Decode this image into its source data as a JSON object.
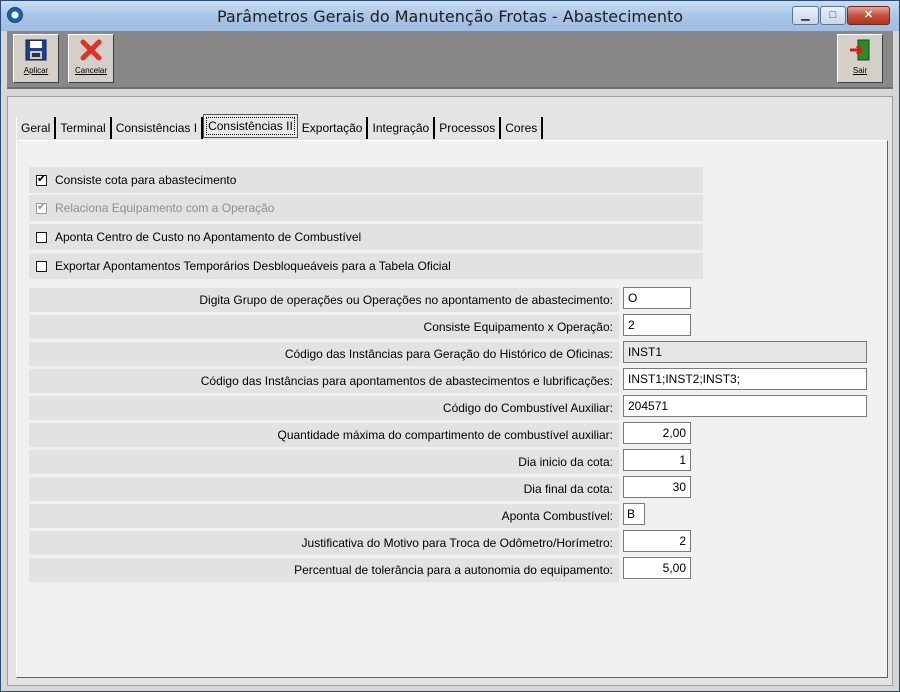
{
  "window": {
    "title": "Parâmetros Gerais do Manutenção Frotas - Abastecimento",
    "min_glyph": "▁",
    "max_glyph": "□",
    "close_glyph": "✕"
  },
  "toolbar": {
    "apply_label": "Aplicar",
    "cancel_label": "Cancelar",
    "exit_label": "Sair"
  },
  "tabs": [
    {
      "label": "Geral"
    },
    {
      "label": "Terminal"
    },
    {
      "label": "Consistências I"
    },
    {
      "label": "Consistências II"
    },
    {
      "label": "Exportação"
    },
    {
      "label": "Integração"
    },
    {
      "label": "Processos"
    },
    {
      "label": "Cores"
    }
  ],
  "active_tab": "Consistências II",
  "checkboxes": [
    {
      "label": "Consiste cota para abastecimento",
      "checked": true,
      "enabled": true
    },
    {
      "label": "Relaciona Equipamento com a Operação",
      "checked": true,
      "enabled": false
    },
    {
      "label": "Aponta Centro de Custo no Apontamento de Combustível",
      "checked": false,
      "enabled": true
    },
    {
      "label": "Exportar Apontamentos Temporários Desbloqueáveis para a Tabela Oficial",
      "checked": false,
      "enabled": true
    }
  ],
  "fields": [
    {
      "label": "Digita Grupo de operações  ou Operações no apontamento de abastecimento:",
      "value": "O"
    },
    {
      "label": "Consiste Equipamento x Operação:",
      "value": "2"
    },
    {
      "label": "Código das Instâncias para Geração do Histórico de Oficinas:",
      "value": "INST1"
    },
    {
      "label": "Código das Instâncias para apontamentos de abastecimentos e lubrificações:",
      "value": "INST1;INST2;INST3;"
    },
    {
      "label": "Código do Combustível Auxiliar:",
      "value": "204571"
    },
    {
      "label": "Quantidade máxima do compartimento de combustível auxiliar:",
      "value": "2,00"
    },
    {
      "label": "Dia inicio da cota:",
      "value": "1"
    },
    {
      "label": "Dia final da cota:",
      "value": "30"
    },
    {
      "label": "Aponta Combustível:",
      "value": "B"
    },
    {
      "label": "Justificativa do Motivo para Troca de Odômetro/Horímetro:",
      "value": "2"
    },
    {
      "label": "Percentual de tolerância para a autonomia do equipamento:",
      "value": "5,00"
    }
  ]
}
